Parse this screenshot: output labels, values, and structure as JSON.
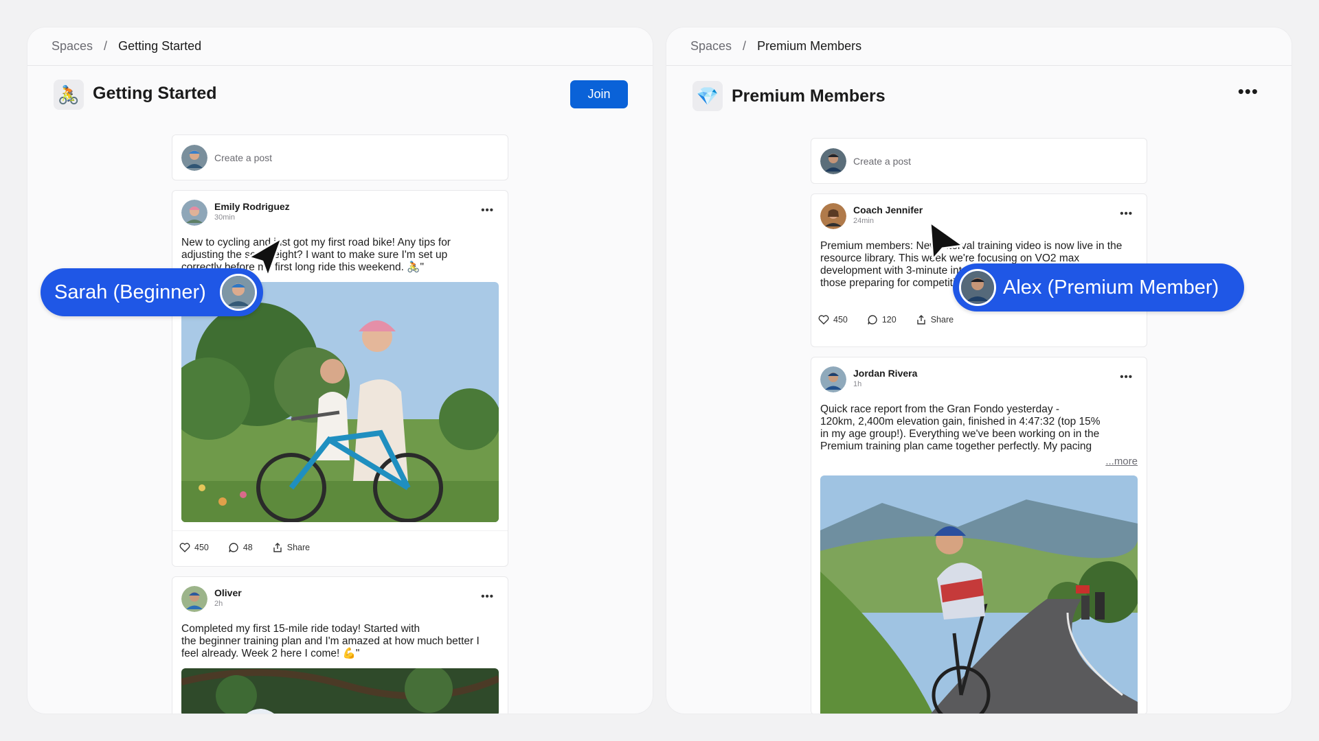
{
  "left": {
    "breadcrumb": {
      "root": "Spaces",
      "separator": "/",
      "current": "Getting Started"
    },
    "space": {
      "icon": "🚴",
      "title": "Getting Started",
      "join_label": "Join"
    },
    "create_post_placeholder": "Create a post",
    "posts": [
      {
        "author": "Emily Rodriguez",
        "time": "30min",
        "text": "New to cycling and just got my first road bike! Any tips for\nadjusting the seat height? I want to make sure I'm set up\ncorrectly before my first long ride this weekend. 🚴\"",
        "likes": "450",
        "comments": "48",
        "share": "Share",
        "image": "girl riding blue bicycle in park"
      },
      {
        "author": "Oliver",
        "time": "2h",
        "text": "Completed my first 15-mile ride today! Started with\nthe beginner training plan and I'm amazed at how much better I\nfeel already. Week 2 here I come! 💪\"",
        "image": "trees and cyclist helmet"
      }
    ]
  },
  "right": {
    "breadcrumb": {
      "root": "Spaces",
      "separator": "/",
      "current": "Premium Members"
    },
    "space": {
      "icon": "💎",
      "title": "Premium Members",
      "menu": "•••"
    },
    "create_post_placeholder": "Create a post",
    "posts": [
      {
        "author": "Coach Jennifer",
        "time": "24min",
        "text": "Premium members: New interval training video is now live in the\nresource library. This week we're focusing on VO2 max\ndevelopment with 3-minute intervals at\nthose preparing for competition",
        "likes": "450",
        "comments": "120",
        "share": "Share"
      },
      {
        "author": "Jordan Rivera",
        "time": "1h",
        "text": "Quick race report from the Gran Fondo yesterday -\n120km, 2,400m elevation gain, finished in 4:47:32 (top 15%\nin my age group!). Everything we've been working on in the\nPremium training plan came together perfectly. My pacing",
        "more": "...more",
        "image": "road cyclist climbing mountain road"
      }
    ]
  },
  "overlays": {
    "sarah_label": "Sarah (Beginner)",
    "alex_label": "Alex (Premium Member)"
  },
  "colors": {
    "accent": "#0a62d8",
    "pill": "#1f57e6",
    "background": "#f2f2f3"
  }
}
